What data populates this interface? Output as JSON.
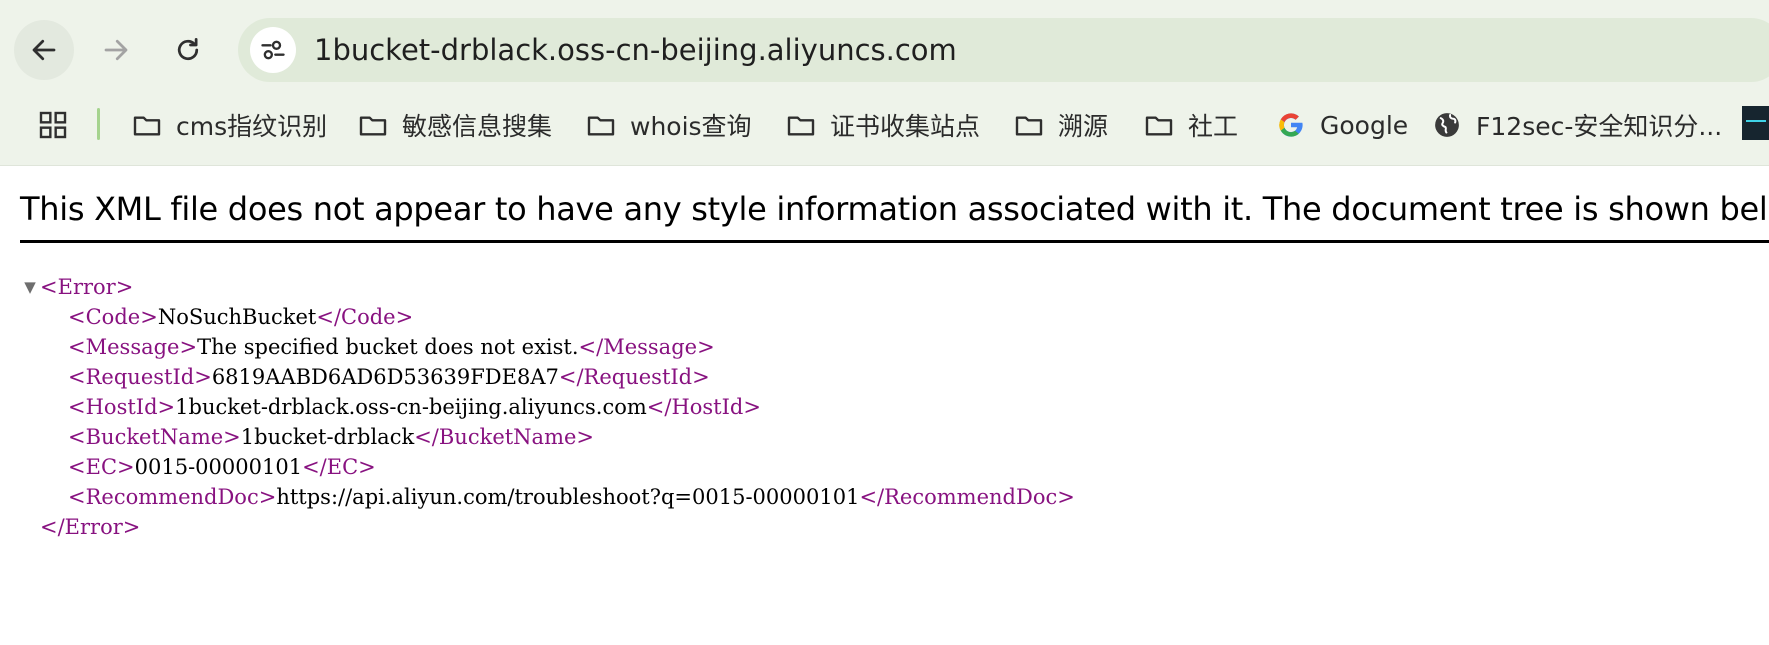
{
  "browser": {
    "url": "1bucket-drblack.oss-cn-beijing.aliyuncs.com",
    "bookmarks": [
      {
        "label": "cms指纹识别",
        "icon": "folder-icon"
      },
      {
        "label": "敏感信息搜集",
        "icon": "folder-icon"
      },
      {
        "label": "whois查询",
        "icon": "folder-icon"
      },
      {
        "label": "证书收集站点",
        "icon": "folder-icon"
      },
      {
        "label": "溯源",
        "icon": "folder-icon"
      },
      {
        "label": "社工",
        "icon": "folder-icon"
      },
      {
        "label": "Google",
        "icon": "google-icon"
      },
      {
        "label": "F12sec-安全知识分...",
        "icon": "globe-icon"
      }
    ]
  },
  "xml_viewer": {
    "banner": "This XML file does not appear to have any style information associated with it. The document tree is shown below.",
    "root": {
      "tag": "Error"
    },
    "children": [
      {
        "tag": "Code",
        "value": "NoSuchBucket"
      },
      {
        "tag": "Message",
        "value": "The specified bucket does not exist."
      },
      {
        "tag": "RequestId",
        "value": "6819AABD6AD6D53639FDE8A7"
      },
      {
        "tag": "HostId",
        "value": "1bucket-drblack.oss-cn-beijing.aliyuncs.com"
      },
      {
        "tag": "BucketName",
        "value": "1bucket-drblack"
      },
      {
        "tag": "EC",
        "value": "0015-00000101"
      },
      {
        "tag": "RecommendDoc",
        "value": "https://api.aliyun.com/troubleshoot?q=0015-00000101"
      }
    ]
  },
  "colors": {
    "tag": "#881280",
    "toolbar_bg": "#eef3ea",
    "omnibox_bg": "#e0ead9",
    "bookmark_separator": "#a5d38e"
  }
}
